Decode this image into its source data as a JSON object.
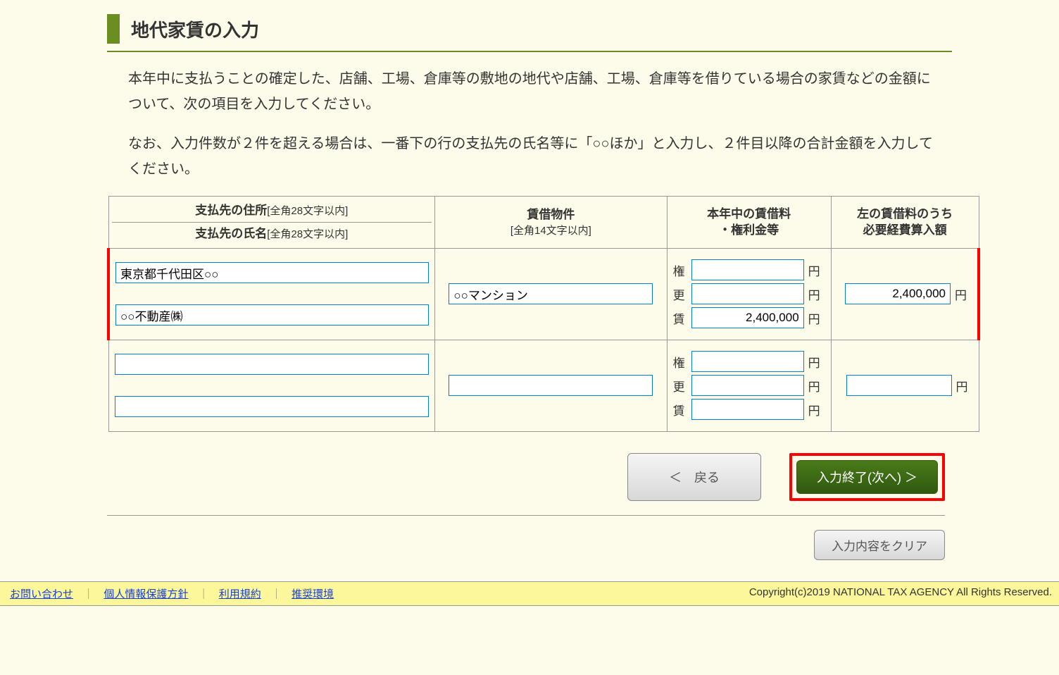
{
  "title": "地代家賃の入力",
  "desc1": "本年中に支払うことの確定した、店舗、工場、倉庫等の敷地の地代や店舗、工場、倉庫等を借りている場合の家賃などの金額について、次の項目を入力してください。",
  "desc2": "なお、入力件数が２件を超える場合は、一番下の行の支払先の氏名等に「○○ほか」と入力し、２件目以降の合計金額を入力してください。",
  "headers": {
    "addr": "支払先の住所",
    "addr_note": "[全角28文字以内]",
    "name": "支払先の氏名",
    "name_note": "[全角28文字以内]",
    "property": "賃借物件",
    "property_note": "[全角14文字以内]",
    "fees": "本年中の賃借料\n・権利金等",
    "expense": "左の賃借料のうち\n必要経費算入額"
  },
  "fee_labels": {
    "ken": "権",
    "kou": "更",
    "chin": "賃"
  },
  "unit_yen": "円",
  "rows": [
    {
      "addr": "東京都千代田区○○",
      "name": "○○不動産㈱",
      "property": "○○マンション",
      "ken": "",
      "kou": "",
      "chin": "2,400,000",
      "expense": "2,400,000"
    },
    {
      "addr": "",
      "name": "",
      "property": "",
      "ken": "",
      "kou": "",
      "chin": "",
      "expense": ""
    }
  ],
  "buttons": {
    "back": "＜　戻る",
    "next": "入力終了(次へ) ＞",
    "clear": "入力内容をクリア"
  },
  "footer": {
    "links": [
      "お問い合わせ",
      "個人情報保護方針",
      "利用規約",
      "推奨環境"
    ],
    "copyright": "Copyright(c)2019 NATIONAL TAX AGENCY All Rights Reserved."
  }
}
